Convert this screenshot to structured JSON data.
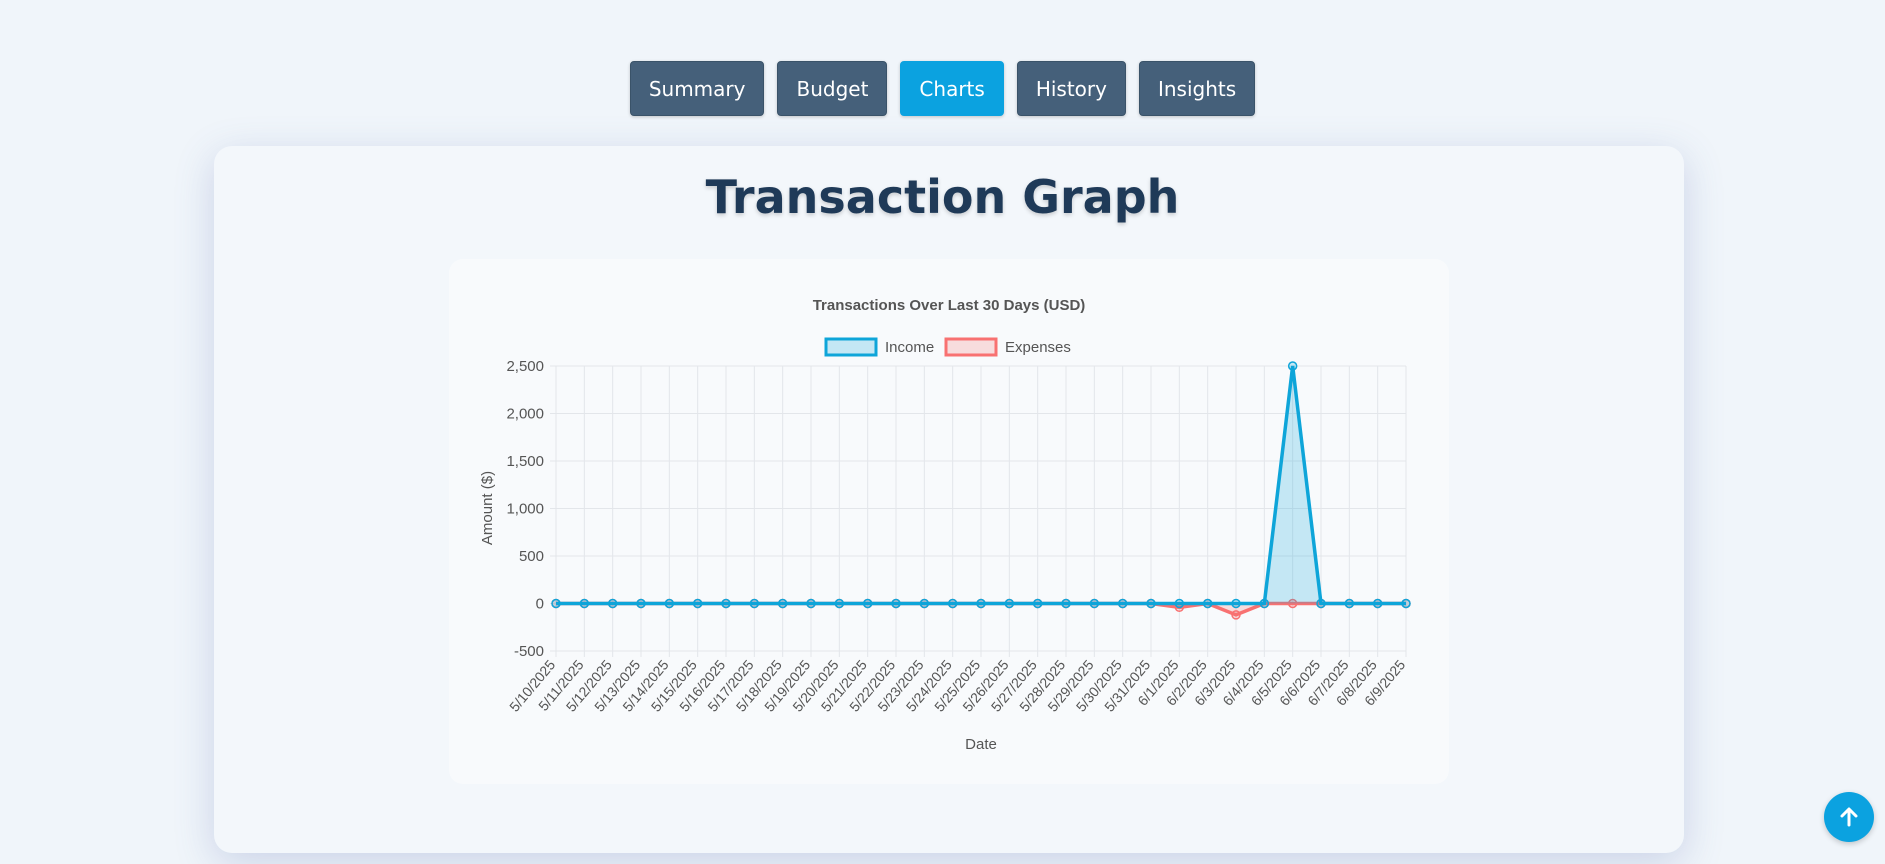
{
  "nav": {
    "tabs": [
      {
        "label": "Summary"
      },
      {
        "label": "Budget"
      },
      {
        "label": "Charts"
      },
      {
        "label": "History"
      },
      {
        "label": "Insights"
      }
    ],
    "active": "Charts"
  },
  "page": {
    "title": "Transaction Graph"
  },
  "scroll_top": {
    "icon": "arrow-up-icon"
  },
  "colors": {
    "accent": "#0ba2e0",
    "nav_bg": "#45607a",
    "income": "#0ea5d9",
    "expenses": "#f87171",
    "title": "#1f3a58"
  },
  "chart_data": {
    "type": "line",
    "title": "Transactions Over Last 30 Days (USD)",
    "xlabel": "Date",
    "ylabel": "Amount ($)",
    "ylim": [
      -500,
      2500
    ],
    "yticks": [
      "2,500",
      "2,000",
      "1,500",
      "1,000",
      "500",
      "0",
      "-500"
    ],
    "grid": true,
    "legend_position": "top",
    "categories": [
      "5/10/2025",
      "5/11/2025",
      "5/12/2025",
      "5/13/2025",
      "5/14/2025",
      "5/15/2025",
      "5/16/2025",
      "5/17/2025",
      "5/18/2025",
      "5/19/2025",
      "5/20/2025",
      "5/21/2025",
      "5/22/2025",
      "5/23/2025",
      "5/24/2025",
      "5/25/2025",
      "5/26/2025",
      "5/27/2025",
      "5/28/2025",
      "5/29/2025",
      "5/30/2025",
      "5/31/2025",
      "6/1/2025",
      "6/2/2025",
      "6/3/2025",
      "6/4/2025",
      "6/5/2025",
      "6/6/2025",
      "6/7/2025",
      "6/8/2025",
      "6/9/2025"
    ],
    "series": [
      {
        "name": "Income",
        "values": [
          0,
          0,
          0,
          0,
          0,
          0,
          0,
          0,
          0,
          0,
          0,
          0,
          0,
          0,
          0,
          0,
          0,
          0,
          0,
          0,
          0,
          0,
          0,
          0,
          0,
          0,
          2500,
          0,
          0,
          0,
          0
        ]
      },
      {
        "name": "Expenses",
        "values": [
          0,
          0,
          0,
          0,
          0,
          0,
          0,
          0,
          0,
          0,
          0,
          0,
          0,
          0,
          0,
          0,
          0,
          0,
          0,
          0,
          0,
          0,
          -40,
          0,
          -120,
          0,
          0,
          0,
          0,
          0,
          0
        ]
      }
    ]
  }
}
